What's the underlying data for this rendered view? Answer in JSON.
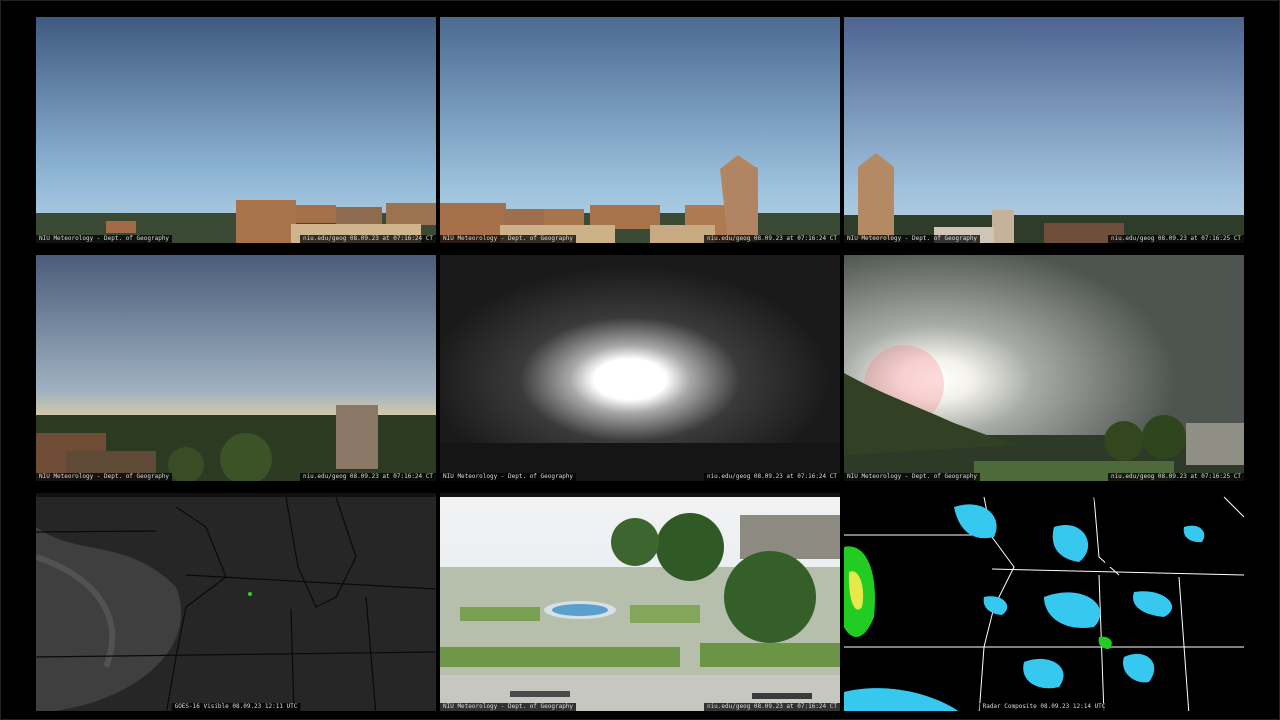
{
  "page": {
    "background": "#000000"
  },
  "grid": {
    "tiles": [
      {
        "id": "cam-1",
        "kind": "webcam",
        "left_caption": "NIU Meteorology - Dept. of Geography",
        "right_caption": "niu.edu/geog  08.09.23 at 07:16:24 CT"
      },
      {
        "id": "cam-2",
        "kind": "webcam",
        "left_caption": "NIU Meteorology - Dept. of Geography",
        "right_caption": "niu.edu/geog  08.09.23 at 07:16:24 CT"
      },
      {
        "id": "cam-3",
        "kind": "webcam",
        "left_caption": "NIU Meteorology - Dept. of Geography",
        "right_caption": "niu.edu/geog  08.09.23 at 07:16:25 CT"
      },
      {
        "id": "cam-4",
        "kind": "webcam",
        "left_caption": "NIU Meteorology - Dept. of Geography",
        "right_caption": "niu.edu/geog  08.09.23 at 07:16:24 CT"
      },
      {
        "id": "cam-5",
        "kind": "sun-webcam",
        "left_caption": "NIU Meteorology - Dept. of Geography",
        "right_caption": "niu.edu/geog  08.09.23 at 07:16:24 CT"
      },
      {
        "id": "cam-6",
        "kind": "sun-webcam",
        "left_caption": "NIU Meteorology - Dept. of Geography",
        "right_caption": "niu.edu/geog  08.09.23 at 07:16:25 CT"
      },
      {
        "id": "satellite",
        "kind": "satellite",
        "bottom_caption": "GOES-16 Visible  08.09.23  12:11 UTC"
      },
      {
        "id": "cam-quad",
        "kind": "webcam",
        "left_caption": "NIU Meteorology - Dept. of Geography",
        "right_caption": "niu.edu/geog  08.09.23 at 07:16:24 CT"
      },
      {
        "id": "radar",
        "kind": "radar",
        "bottom_caption": "Radar Composite  08.09.23  12:14 UTC"
      }
    ]
  },
  "colors": {
    "sky_top": "#4d6a94",
    "sky_bottom": "#a9c8e3",
    "brick": "#b07e57",
    "radar_blue": "#37c8f0",
    "radar_green": "#22cc22",
    "radar_yellow": "#e8e84a"
  }
}
